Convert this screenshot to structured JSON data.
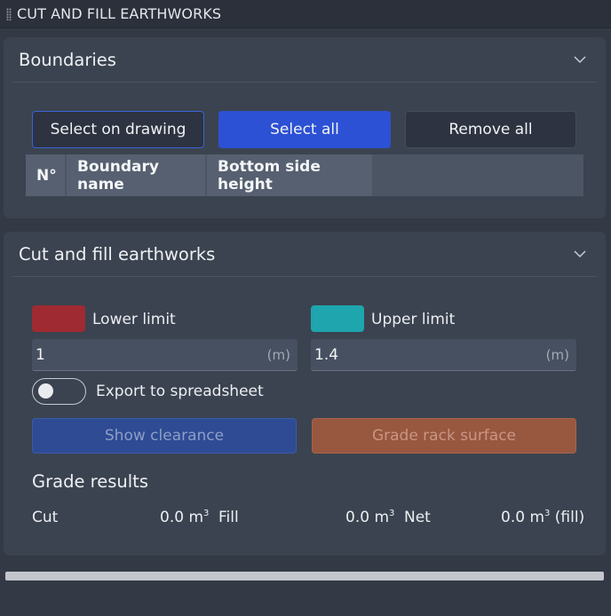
{
  "window": {
    "title": "CUT AND FILL EARTHWORKS"
  },
  "boundaries": {
    "title": "Boundaries",
    "buttons": {
      "select_on_drawing": "Select on drawing",
      "select_all": "Select all",
      "remove_all": "Remove all"
    },
    "table": {
      "columns": [
        "N°",
        "Boundary name",
        "Bottom side height"
      ],
      "rows": []
    }
  },
  "cutfill": {
    "title": "Cut and fill earthworks",
    "lower_limit": {
      "label": "Lower limit",
      "value": "1",
      "unit": "(m)",
      "color": "#a02a31"
    },
    "upper_limit": {
      "label": "Upper limit",
      "value": "1.4",
      "unit": "(m)",
      "color": "#1ea5ad"
    },
    "export_label": "Export to spreadsheet",
    "export_enabled": false,
    "show_clearance": "Show clearance",
    "grade_rack": "Grade rack surface",
    "results_title": "Grade results",
    "results": {
      "cut_label": "Cut",
      "cut_value": "0.0 m",
      "cut_unit_sup": "3",
      "fill_label": "Fill",
      "fill_value": "0.0 m",
      "fill_unit_sup": "3",
      "net_label": "Net",
      "net_value": "0.0 m",
      "net_unit_sup": "3",
      "net_suffix": " (fill)"
    }
  },
  "colors": {
    "accent": "#2c51d4",
    "panel": "#3b4350",
    "background": "#333a45",
    "grade_rack": "#98573f"
  },
  "icons": [
    "drag-grip-icon",
    "chevron-down-icon"
  ]
}
